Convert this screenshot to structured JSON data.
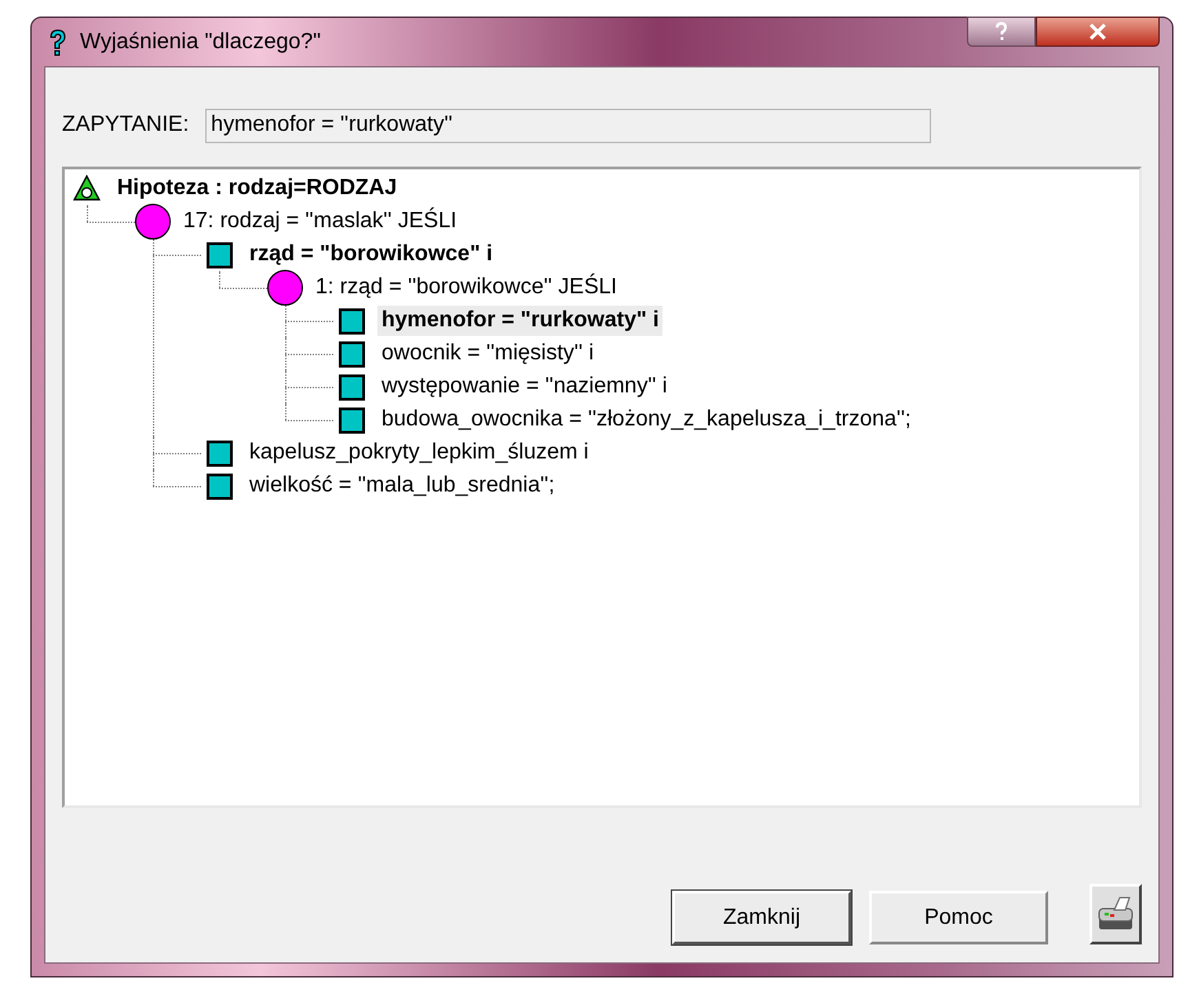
{
  "window": {
    "title": "Wyjaśnienia \"dlaczego?\""
  },
  "query": {
    "label": "ZAPYTANIE:",
    "value": "hymenofor = ''rurkowaty''"
  },
  "tree": {
    "kind": "hypothesis",
    "text": "Hipoteza : rodzaj=RODZAJ",
    "bold": true,
    "selected": false,
    "children": [
      {
        "kind": "rule",
        "text": "17: rodzaj = ''maslak'' JEŚLI",
        "bold": false,
        "selected": false,
        "children": [
          {
            "kind": "condition",
            "text": "rząd = \"borowikowce\" i",
            "bold": true,
            "selected": false,
            "children": [
              {
                "kind": "rule",
                "text": "1: rząd = ''borowikowce'' JEŚLI",
                "bold": false,
                "selected": false,
                "children": [
                  {
                    "kind": "condition",
                    "text": "hymenofor = \"rurkowaty\" i",
                    "bold": true,
                    "selected": true
                  },
                  {
                    "kind": "condition",
                    "text": "owocnik = ''mięsisty'' i",
                    "bold": false,
                    "selected": false
                  },
                  {
                    "kind": "condition",
                    "text": "występowanie = ''naziemny'' i",
                    "bold": false,
                    "selected": false
                  },
                  {
                    "kind": "condition",
                    "text": "budowa_owocnika = ''złożony_z_kapelusza_i_trzona'';",
                    "bold": false,
                    "selected": false
                  }
                ]
              }
            ]
          },
          {
            "kind": "condition",
            "text": "kapelusz_pokryty_lepkim_śluzem i",
            "bold": false,
            "selected": false
          },
          {
            "kind": "condition",
            "text": "wielkość = ''mala_lub_srednia'';",
            "bold": false,
            "selected": false
          }
        ]
      }
    ]
  },
  "buttons": [
    "Zamknij",
    "Pomoc"
  ]
}
